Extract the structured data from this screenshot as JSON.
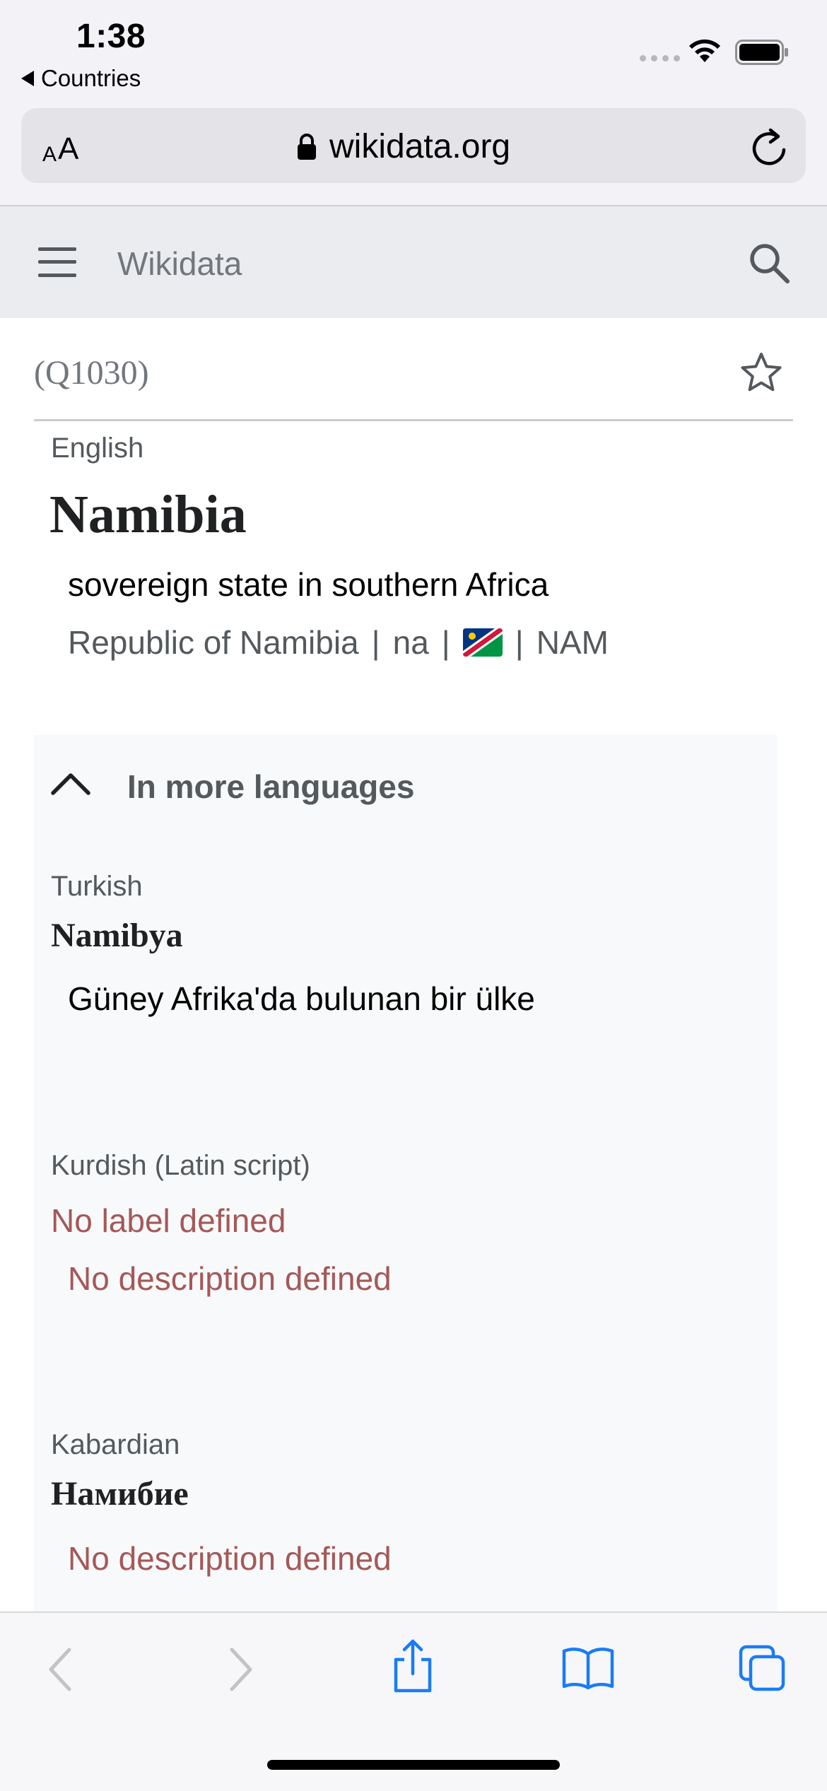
{
  "status_bar": {
    "time": "1:38",
    "back_app_label": "Countries"
  },
  "browser": {
    "text_size_small": "A",
    "text_size_large": "A",
    "domain": "wikidata.org"
  },
  "wikidata_header": {
    "site_title": "Wikidata"
  },
  "item": {
    "qid": "(Q1030)",
    "language": "English",
    "label": "Namibia",
    "description": "sovereign state in southern Africa",
    "aliases": [
      "Republic of Namibia",
      "na",
      "NAM"
    ],
    "alias_separator": "|"
  },
  "more_languages": {
    "title": "In more languages",
    "entries": [
      {
        "language": "Turkish",
        "label": "Namibya",
        "description": "Güney Afrika'da bulunan bir ülke"
      },
      {
        "language": "Kurdish (Latin script)",
        "label": "No label defined",
        "description": "No description defined"
      },
      {
        "language": "Kabardian",
        "label": "Намибие",
        "description": "No description defined"
      }
    ]
  },
  "colors": {
    "missing_text": "#a55858",
    "ios_blue": "#1a7cf5",
    "header_bg": "#eaecf0",
    "panel_bg": "#f8f9fa"
  },
  "icons": {
    "wifi": "wifi-icon",
    "battery": "battery-icon",
    "lock": "lock-icon",
    "reload": "reload-icon",
    "menu": "hamburger-menu-icon",
    "search": "search-icon",
    "star": "star-icon",
    "chevron": "chevron-up-icon",
    "flag": "namibia-flag-icon",
    "back": "chevron-left-icon",
    "forward": "chevron-right-icon",
    "share": "share-icon",
    "bookmarks": "book-icon",
    "tabs": "tabs-icon"
  }
}
